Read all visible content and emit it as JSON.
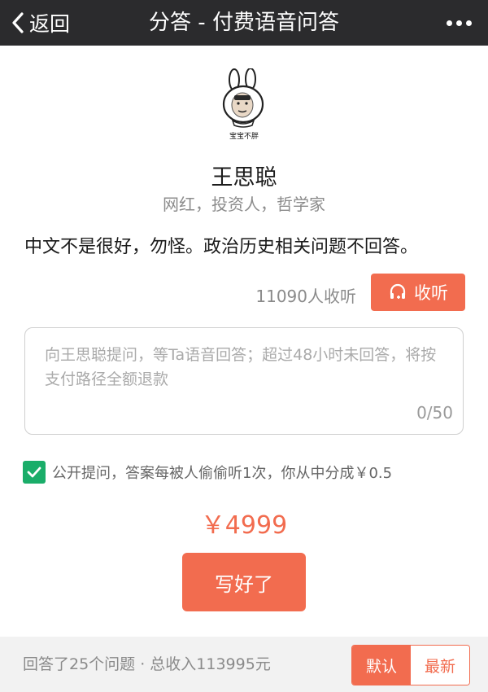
{
  "navbar": {
    "back_label": "返回",
    "title": "分答 - 付费语音问答"
  },
  "profile": {
    "avatar_caption": "宝宝不胖",
    "name": "王思聪",
    "tagline": "网红，投资人，哲学家",
    "intro": "中文不是很好，勿怪。政治历史相关问题不回答。"
  },
  "listen": {
    "count_text": "11090人收听",
    "button_label": "收听"
  },
  "question": {
    "placeholder": "向王思聪提问，等Ta语音回答；超过48小时未回答，将按支付路径全额退款",
    "value": "",
    "counter": "0/50"
  },
  "public_option": {
    "checked": true,
    "label": "公开提问，答案每被人偷偷听1次，你从中分成￥0.5"
  },
  "price": "￥4999",
  "submit_label": "写好了",
  "footer": {
    "stats": "回答了25个问题 · 总收入113995元",
    "sort_default": "默认",
    "sort_latest": "最新"
  },
  "colors": {
    "accent": "#f26c4f",
    "navbar": "#2b2b2d",
    "check": "#1aad69"
  },
  "icons": {
    "back": "chevron-left-icon",
    "more": "more-dots-icon",
    "headphone": "headphone-plus-icon",
    "check": "check-icon"
  }
}
